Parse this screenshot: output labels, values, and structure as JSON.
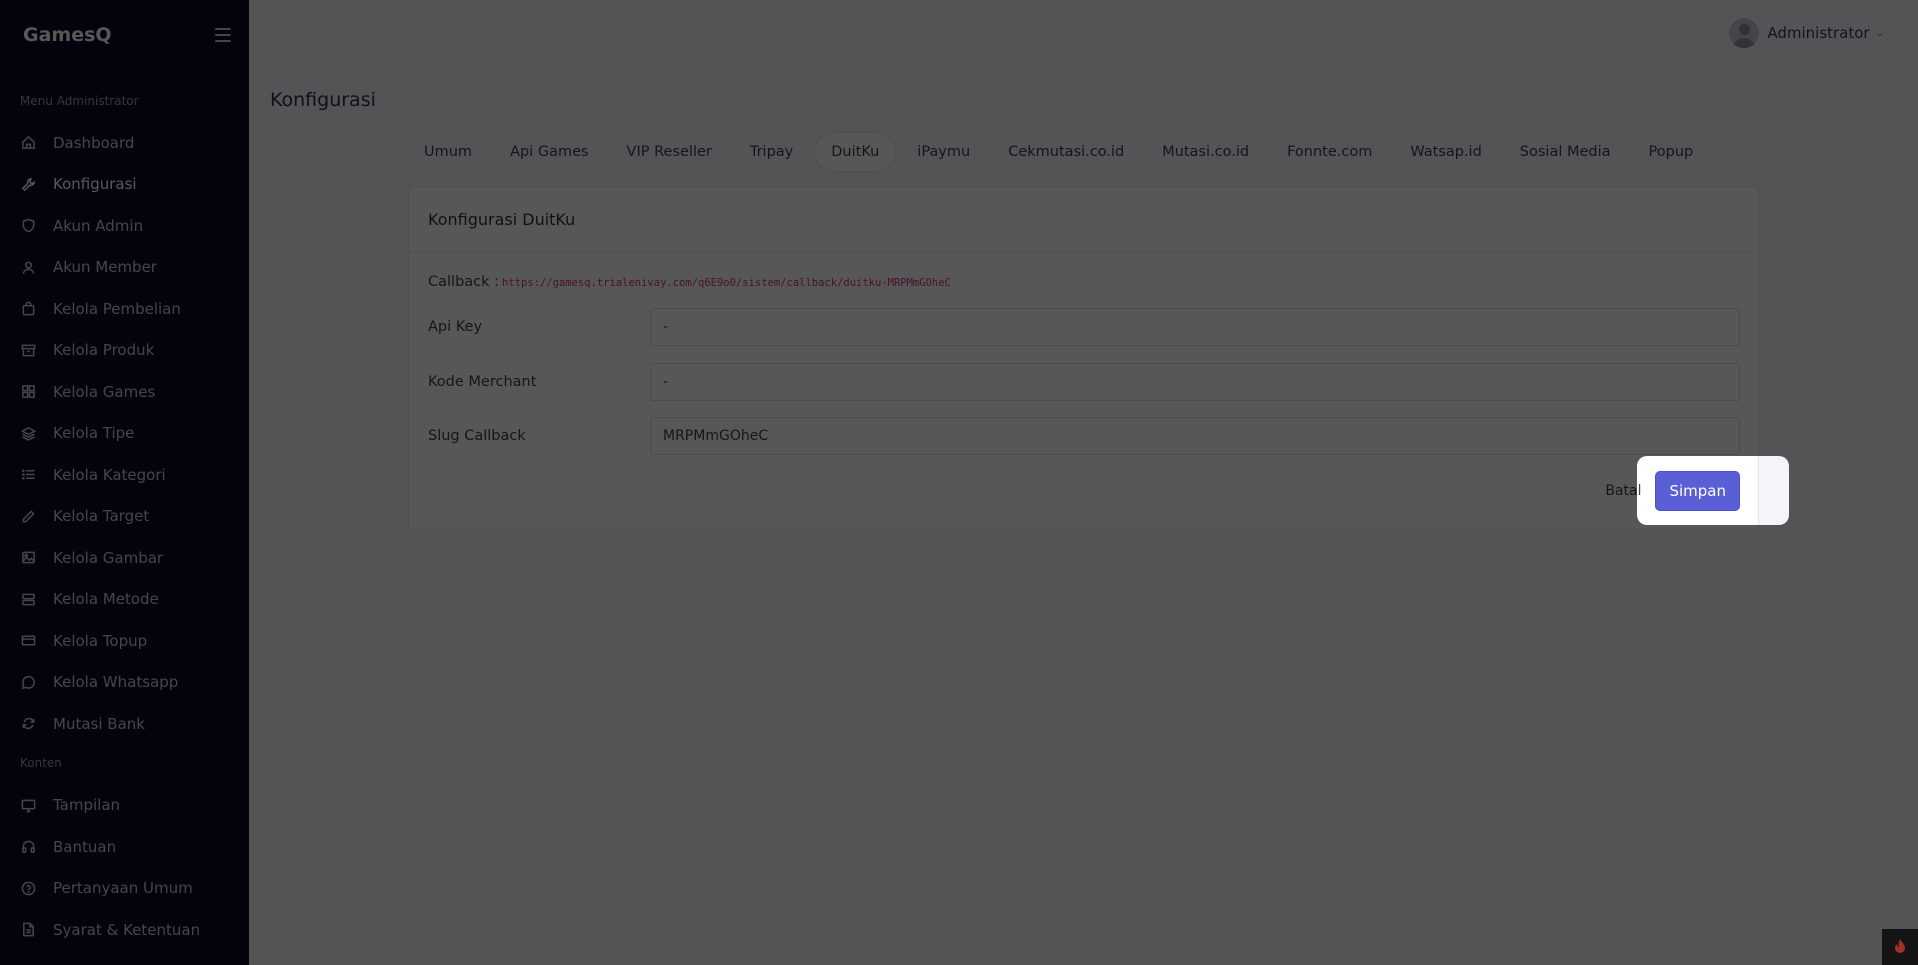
{
  "sidebar": {
    "brand": "GamesQ",
    "section_admin": "Menu Administrator",
    "section_content": "Konten",
    "items": [
      {
        "label": "Dashboard",
        "icon": "home-icon"
      },
      {
        "label": "Konfigurasi",
        "icon": "wrench-icon",
        "active": true
      },
      {
        "label": "Akun Admin",
        "icon": "shield-icon"
      },
      {
        "label": "Akun Member",
        "icon": "user-icon"
      },
      {
        "label": "Kelola Pembelian",
        "icon": "shopping-bag-icon"
      },
      {
        "label": "Kelola Produk",
        "icon": "archive-icon"
      },
      {
        "label": "Kelola Games",
        "icon": "grid-icon"
      },
      {
        "label": "Kelola Tipe",
        "icon": "layers-icon"
      },
      {
        "label": "Kelola Kategori",
        "icon": "list-icon"
      },
      {
        "label": "Kelola Target",
        "icon": "pencil-icon"
      },
      {
        "label": "Kelola Gambar",
        "icon": "image-icon"
      },
      {
        "label": "Kelola Metode",
        "icon": "server-icon"
      },
      {
        "label": "Kelola Topup",
        "icon": "credit-card-icon"
      },
      {
        "label": "Kelola Whatsapp",
        "icon": "chat-icon"
      },
      {
        "label": "Mutasi Bank",
        "icon": "refresh-icon"
      }
    ],
    "content_items": [
      {
        "label": "Tampilan",
        "icon": "monitor-icon"
      },
      {
        "label": "Bantuan",
        "icon": "headphones-icon"
      },
      {
        "label": "Pertanyaan Umum",
        "icon": "help-circle-icon"
      },
      {
        "label": "Syarat & Ketentuan",
        "icon": "file-text-icon"
      }
    ]
  },
  "header": {
    "user_name": "Administrator"
  },
  "page": {
    "title": "Konfigurasi"
  },
  "tabs": [
    {
      "label": "Umum"
    },
    {
      "label": "Api Games"
    },
    {
      "label": "VIP Reseller"
    },
    {
      "label": "Tripay"
    },
    {
      "label": "DuitKu",
      "active": true
    },
    {
      "label": "iPaymu"
    },
    {
      "label": "Cekmutasi.co.id"
    },
    {
      "label": "Mutasi.co.id"
    },
    {
      "label": "Fonnte.com"
    },
    {
      "label": "Watsap.id"
    },
    {
      "label": "Sosial Media"
    },
    {
      "label": "Popup"
    }
  ],
  "card": {
    "title": "Konfigurasi DuitKu",
    "callback_label": "Callback :",
    "callback_url": "https://gamesq.trialenivay.com/q6E9o0/sistem/callback/duitku-MRPMmGOheC",
    "fields": [
      {
        "label": "Api Key",
        "value": "-"
      },
      {
        "label": "Kode Merchant",
        "value": "-"
      },
      {
        "label": "Slug Callback",
        "value": "MRPMmGOheC"
      }
    ],
    "cancel_label": "Batal",
    "save_label": "Simpan"
  },
  "colors": {
    "sidebar_bg": "#0b0b2b",
    "primary": "#5b5fd6",
    "callback_url": "#d63384"
  }
}
